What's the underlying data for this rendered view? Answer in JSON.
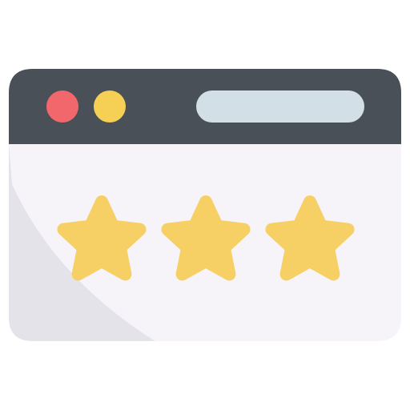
{
  "icon": {
    "name": "browser-rating-icon",
    "rating": {
      "value": 3,
      "max": 3
    },
    "colors": {
      "title_bar": "#4a5058",
      "window_body": "#f6f4f9",
      "shadow": "#e4e3e9",
      "close_dot": "#f2676b",
      "minimize_dot": "#f6cf55",
      "address_bar": "#d3dfe7",
      "star": "#f6d064"
    }
  }
}
